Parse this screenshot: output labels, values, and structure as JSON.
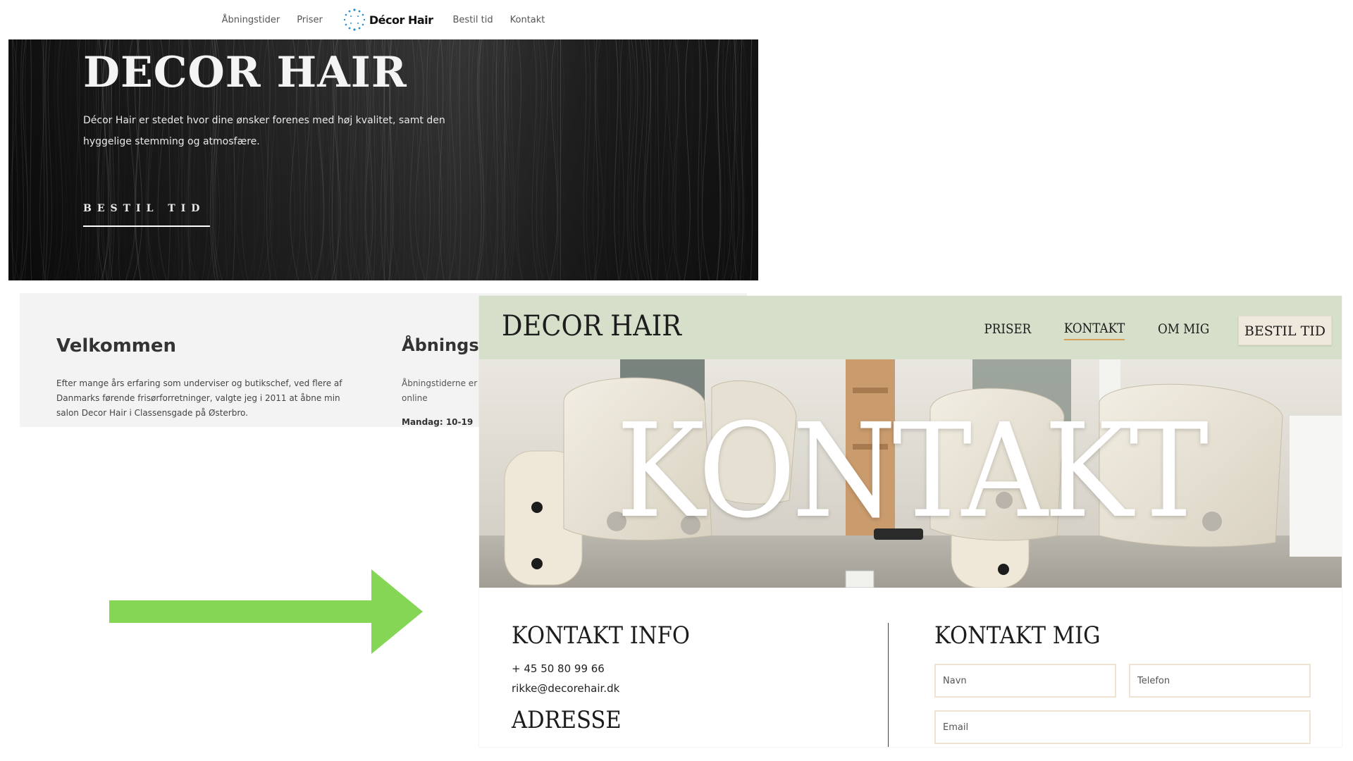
{
  "old_site": {
    "nav": {
      "items": [
        "Åbningstider",
        "Priser",
        "Bestil tid",
        "Kontakt"
      ],
      "logo_text": "Décor Hair"
    },
    "hero": {
      "title": "DECOR HAIR",
      "text": "Décor Hair er stedet hvor dine ønsker forenes med høj kvalitet, samt den hyggelige stemming og atmosfære.",
      "cta": "BESTIL TID"
    },
    "welcome": {
      "title": "Velkommen",
      "text": "Efter mange års erfaring som underviser og butikschef, ved flere af Danmarks førende  frisørforretninger, valgte jeg i 2011 at åbne min salon Decor Hair i Classensgade på Østerbro."
    },
    "hours": {
      "title": "Åbningstider",
      "text": "Åbningstiderne er Tjek derfor online",
      "first_day": "Mandag: 10-19"
    }
  },
  "new_site": {
    "brand": "DECOR HAIR",
    "nav": {
      "priser": "PRISER",
      "kontakt": "KONTAKT",
      "om_mig": "OM MIG",
      "bestil_tid": "BESTIL TID"
    },
    "hero_word": "KONTAKT",
    "contact_info": {
      "title": "KONTAKT INFO",
      "phone": "+ 45 50 80 99 66",
      "email": "rikke@decorehair.dk",
      "address_title": "ADRESSE"
    },
    "contact_form": {
      "title": "KONTAKT MIG",
      "name_placeholder": "Navn",
      "phone_placeholder": "Telefon",
      "email_placeholder": "Email"
    }
  },
  "colors": {
    "header_green": "#d6dfc9",
    "arrow_green": "#84d654",
    "nav_underline": "#d6a25a",
    "field_border": "#efe3d2"
  }
}
